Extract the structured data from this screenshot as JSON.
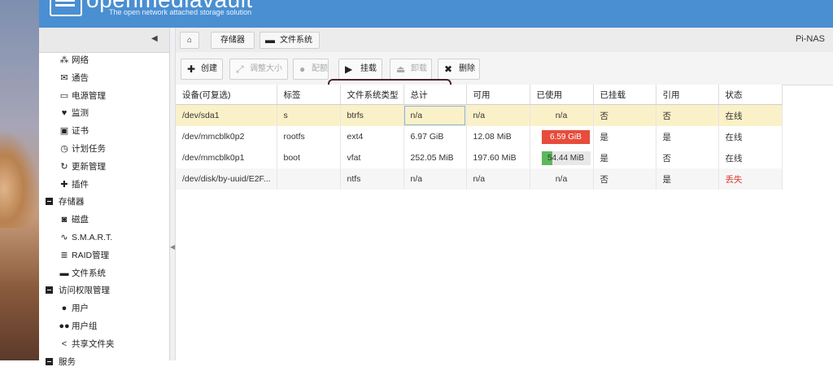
{
  "app": {
    "logo_text": "openmediavault",
    "tagline": "The open network attached storage solution",
    "hostname": "Pi-NAS"
  },
  "breadcrumb": {
    "storage": "存储器",
    "filesystem": "文件系统"
  },
  "sidebar": {
    "items": [
      {
        "label": "网络",
        "icon": "network-icon",
        "glyph": "⁂"
      },
      {
        "label": "通告",
        "icon": "mail-icon",
        "glyph": "✉"
      },
      {
        "label": "电源管理",
        "icon": "battery-icon",
        "glyph": "▭"
      },
      {
        "label": "监测",
        "icon": "heartbeat-icon",
        "glyph": "♥"
      },
      {
        "label": "证书",
        "icon": "certificate-icon",
        "glyph": "▣"
      },
      {
        "label": "计划任务",
        "icon": "calendar-clock-icon",
        "glyph": "◷"
      },
      {
        "label": "更新管理",
        "icon": "refresh-icon",
        "glyph": "↻"
      },
      {
        "label": "插件",
        "icon": "puzzle-icon",
        "glyph": "✚"
      }
    ],
    "storage_group": "存储器",
    "storage_items": [
      {
        "label": "磁盘",
        "icon": "disk-icon",
        "glyph": "◙"
      },
      {
        "label": "S.M.A.R.T.",
        "icon": "pulse-icon",
        "glyph": "∿"
      },
      {
        "label": "RAID管理",
        "icon": "database-icon",
        "glyph": "≣"
      },
      {
        "label": "文件系统",
        "icon": "folder-icon",
        "glyph": "▬"
      }
    ],
    "access_group": "访问权限管理",
    "access_items": [
      {
        "label": "用户",
        "icon": "user-icon",
        "glyph": "●"
      },
      {
        "label": "用户组",
        "icon": "users-icon",
        "glyph": "●●"
      },
      {
        "label": "共享文件夹",
        "icon": "share-icon",
        "glyph": "<"
      }
    ],
    "services_group": "服务"
  },
  "toolbar": {
    "create": "创建",
    "resize": "调整大小",
    "quota": "配额",
    "mount": "挂载",
    "unmount": "卸载",
    "delete": "删除"
  },
  "table": {
    "columns": [
      "设备(可复选)",
      "标签",
      "文件系统类型",
      "总计",
      "可用",
      "已使用",
      "已挂载",
      "引用",
      "状态"
    ],
    "rows": [
      {
        "device": "/dev/sda1",
        "label": "s",
        "fstype": "btrfs",
        "total": "n/a",
        "available": "n/a",
        "used": "n/a",
        "mounted": "否",
        "referenced": "否",
        "status": "在线"
      },
      {
        "device": "/dev/mmcblk0p2",
        "label": "rootfs",
        "fstype": "ext4",
        "total": "6.97 GiB",
        "available": "12.08 MiB",
        "used": "6.59 GiB",
        "used_pct": 99,
        "used_color": "#e74c3c",
        "mounted": "是",
        "referenced": "是",
        "status": "在线"
      },
      {
        "device": "/dev/mmcblk0p1",
        "label": "boot",
        "fstype": "vfat",
        "total": "252.05 MiB",
        "available": "197.60 MiB",
        "used": "54.44 MiB",
        "used_pct": 22,
        "used_color": "#5cb85c",
        "mounted": "是",
        "referenced": "否",
        "status": "在线"
      },
      {
        "device": "/dev/disk/by-uuid/E2F...",
        "label": "",
        "fstype": "ntfs",
        "total": "n/a",
        "available": "n/a",
        "used": "n/a",
        "mounted": "否",
        "referenced": "是",
        "status": "丢失",
        "status_color": "#e0342a"
      }
    ]
  }
}
